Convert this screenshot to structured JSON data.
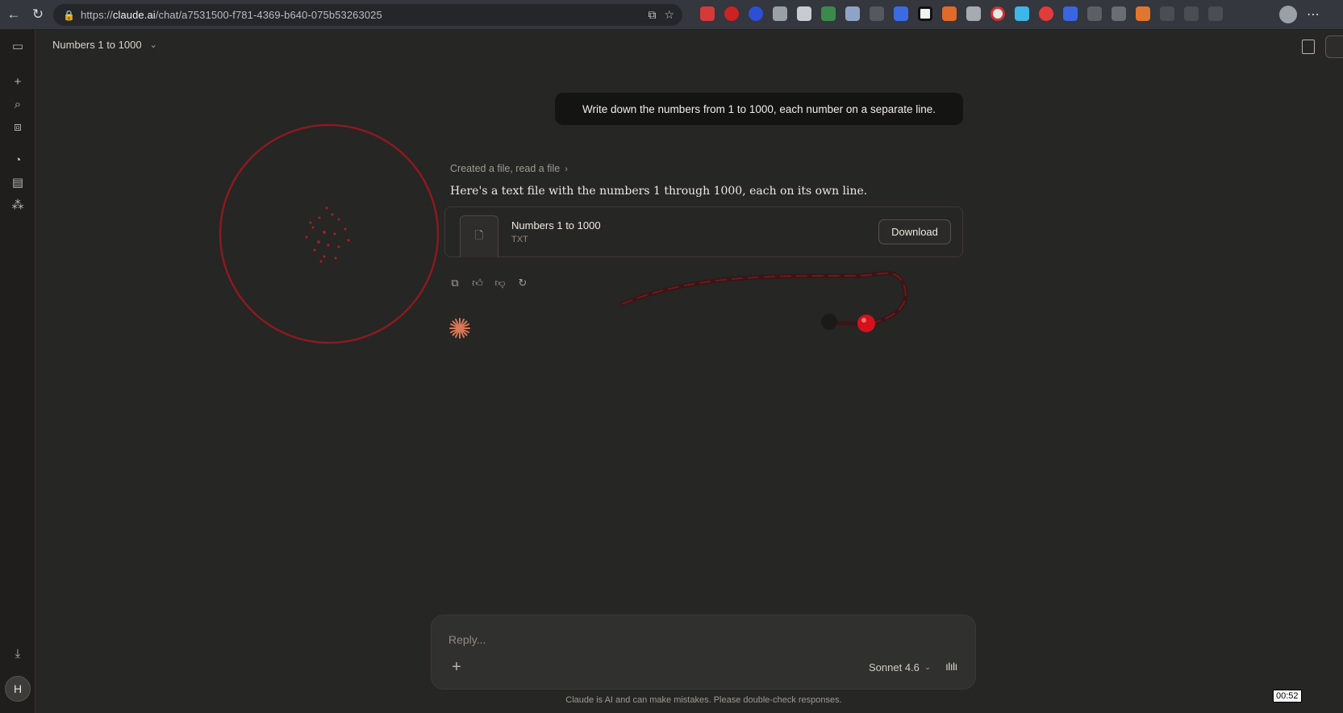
{
  "browser": {
    "url_host": "claude.ai",
    "url_prefix": "https://",
    "url_path": "/chat/a7531500-f781-4369-b640-075b53263025"
  },
  "header": {
    "title": "Numbers 1 to 1000"
  },
  "conversation": {
    "user_message": "Write down the numbers from 1 to 1000, each number on a separate line.",
    "tool_summary": "Created a file, read a file",
    "assistant_text": "Here's a text file with the numbers 1 through 1000, each on its own line.",
    "file": {
      "name": "Numbers 1 to 1000",
      "type": "TXT",
      "download_label": "Download"
    }
  },
  "composer": {
    "placeholder": "Reply...",
    "model": "Sonnet 4.6"
  },
  "footer": {
    "disclaimer": "Claude is AI and can make mistakes. Please double-check responses."
  },
  "sidebar": {
    "avatar_initial": "H"
  },
  "overlay": {
    "timer": "00:52"
  },
  "colors": {
    "background": "#262624",
    "accent_spark": "#d97757",
    "annotation_red": "#8b1a1f"
  }
}
